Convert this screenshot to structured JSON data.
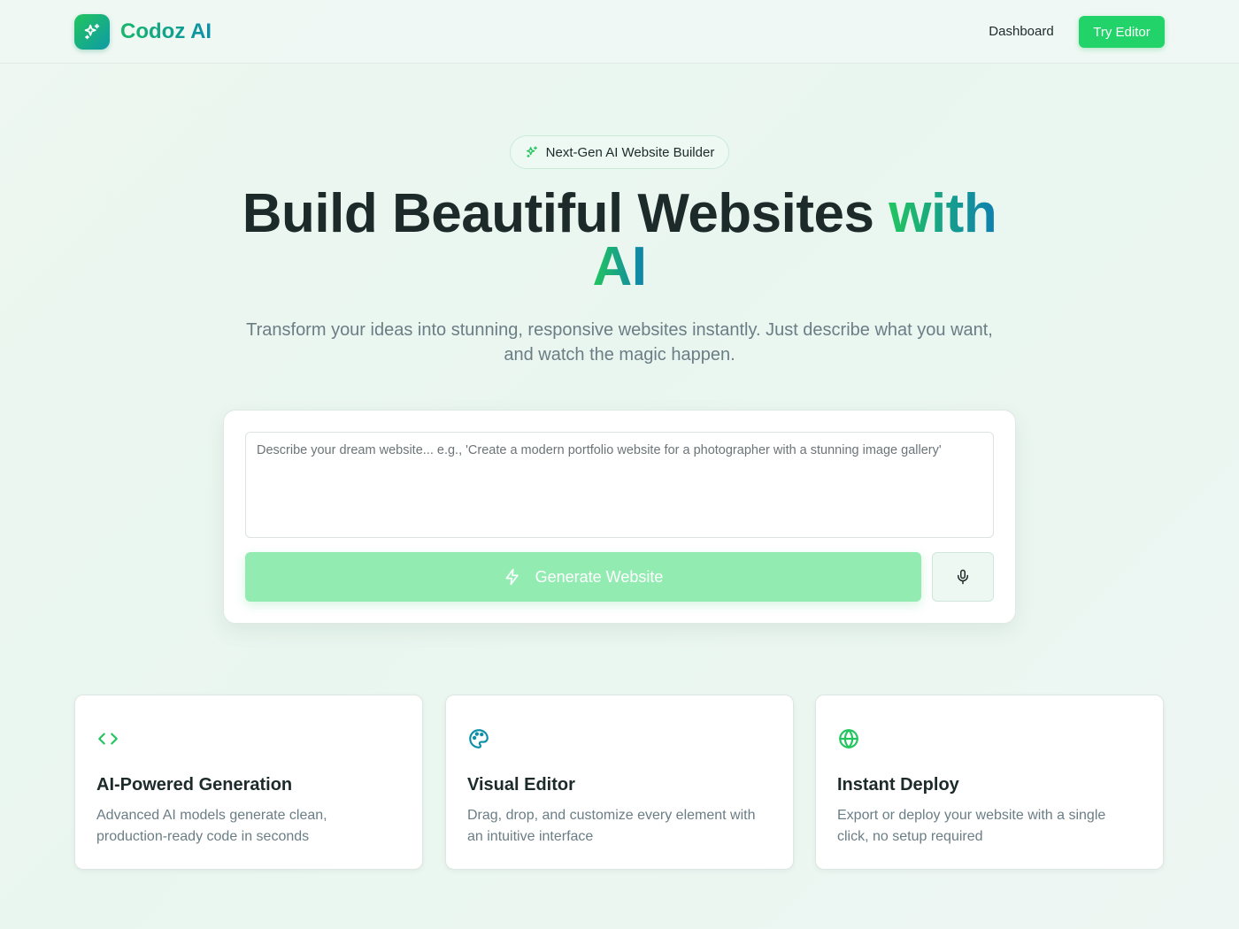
{
  "header": {
    "brand_name": "Codoz AI",
    "brand_icon": "sparkles-icon",
    "nav_dashboard": "Dashboard",
    "nav_try_editor": "Try Editor"
  },
  "hero": {
    "badge_text": "Next-Gen AI Website Builder",
    "badge_icon": "sparkles-icon",
    "headline_main": "Build Beautiful Websites ",
    "headline_accent_1": "with",
    "headline_accent_2": "AI",
    "subtitle": "Transform your ideas into stunning, responsive websites instantly. Just describe what you want, and watch the magic happen."
  },
  "prompt": {
    "placeholder": "Describe your dream website... e.g., 'Create a modern portfolio website for a photographer with a stunning image gallery'",
    "value": "",
    "generate_label": "Generate Website",
    "generate_icon": "lightning-icon",
    "mic_icon": "microphone-icon"
  },
  "features": [
    {
      "icon": "code-icon",
      "title": "AI-Powered Generation",
      "description": "Advanced AI models generate clean, production-ready code in seconds"
    },
    {
      "icon": "palette-icon",
      "title": "Visual Editor",
      "description": "Drag, drop, and customize every element with an intuitive interface"
    },
    {
      "icon": "globe-icon",
      "title": "Instant Deploy",
      "description": "Export or deploy your website with a single click, no setup required"
    }
  ],
  "colors": {
    "accent_green": "#22c55e",
    "accent_teal": "#0e8fa8",
    "button_green": "#22d36a",
    "button_disabled": "#92ecb2"
  }
}
